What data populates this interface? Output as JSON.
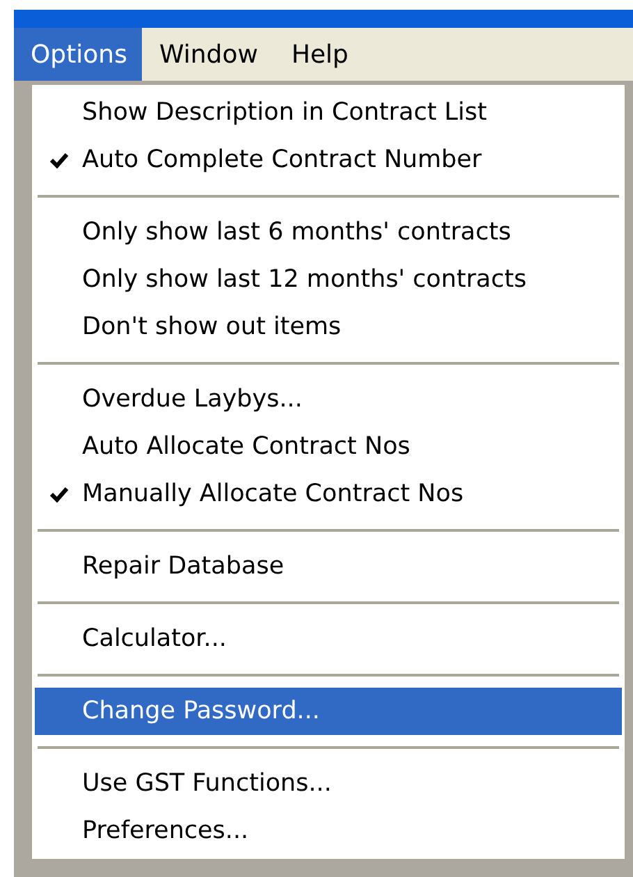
{
  "menu_bar": [
    {
      "label": "Options",
      "selected": true
    },
    {
      "label": "Window",
      "selected": false
    },
    {
      "label": "Help",
      "selected": false
    }
  ],
  "menu": [
    {
      "kind": "item",
      "label": "Show Description in Contract List",
      "checked": false,
      "selected": false
    },
    {
      "kind": "item",
      "label": "Auto Complete Contract Number",
      "checked": true,
      "selected": false
    },
    {
      "kind": "separator"
    },
    {
      "kind": "item",
      "label": "Only show last 6 months' contracts",
      "checked": false,
      "selected": false
    },
    {
      "kind": "item",
      "label": "Only show last 12 months' contracts",
      "checked": false,
      "selected": false
    },
    {
      "kind": "item",
      "label": "Don't show out items",
      "checked": false,
      "selected": false
    },
    {
      "kind": "separator"
    },
    {
      "kind": "item",
      "label": "Overdue Laybys...",
      "checked": false,
      "selected": false
    },
    {
      "kind": "item",
      "label": "Auto Allocate Contract Nos",
      "checked": false,
      "selected": false
    },
    {
      "kind": "item",
      "label": "Manually Allocate Contract Nos",
      "checked": true,
      "selected": false
    },
    {
      "kind": "separator"
    },
    {
      "kind": "item",
      "label": "Repair Database",
      "checked": false,
      "selected": false
    },
    {
      "kind": "separator"
    },
    {
      "kind": "item",
      "label": "Calculator...",
      "checked": false,
      "selected": false
    },
    {
      "kind": "separator"
    },
    {
      "kind": "item",
      "label": "Change Password...",
      "checked": false,
      "selected": true
    },
    {
      "kind": "separator"
    },
    {
      "kind": "item",
      "label": "Use GST Functions...",
      "checked": false,
      "selected": false
    },
    {
      "kind": "item",
      "label": "Preferences...",
      "checked": false,
      "selected": false
    }
  ]
}
